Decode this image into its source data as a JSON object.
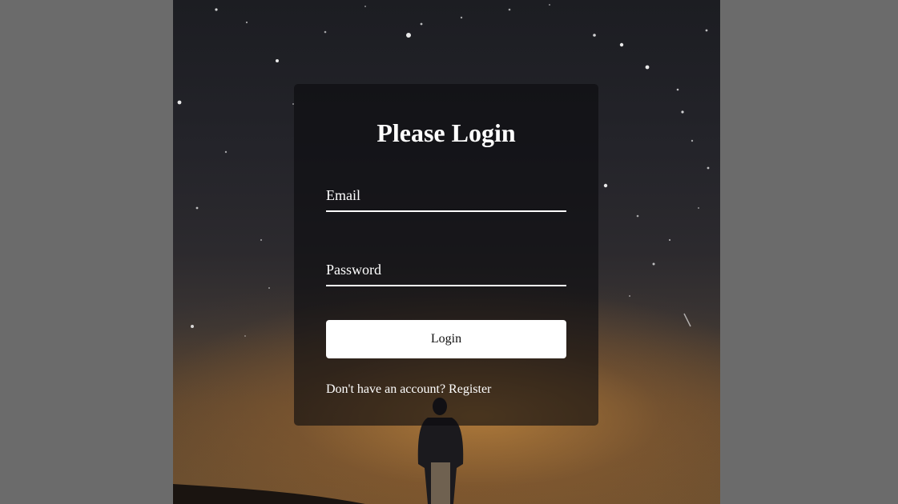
{
  "form": {
    "title": "Please Login",
    "email_label": "Email",
    "password_label": "Password",
    "login_label": "Login",
    "register_prompt": "Don't have an account? ",
    "register_link": "Register"
  },
  "colors": {
    "page_background": "#6b6b6b",
    "card_background": "rgba(12,12,14,0.62)",
    "text": "#ffffff",
    "button_background": "#ffffff",
    "button_text": "#111111"
  },
  "background_image": "night-sky-person-silhouette"
}
